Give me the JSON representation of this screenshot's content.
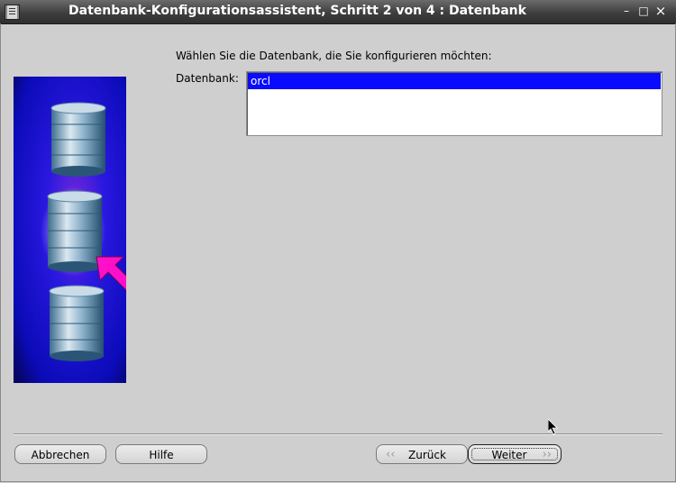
{
  "window": {
    "title": "Datenbank-Konfigurationsassistent, Schritt 2 von 4 : Datenbank",
    "controls": {
      "minimize": "–",
      "maximize": "□",
      "close": "×"
    }
  },
  "main": {
    "prompt": "Wählen Sie die Datenbank, die Sie konfigurieren möchten:",
    "database_label": "Datenbank:",
    "databases": [
      "orcl"
    ],
    "selected_database": "orcl"
  },
  "buttons": {
    "cancel": "Abbrechen",
    "help": "Hilfe",
    "back": "Zurück",
    "next": "Weiter"
  },
  "colors": {
    "titlebar": "#3e3e3e",
    "window_bg": "#cfcfcf",
    "selection": "#0a0aff",
    "highlight_arrow": "#ff10c8",
    "side_panel": "#1010cc"
  }
}
